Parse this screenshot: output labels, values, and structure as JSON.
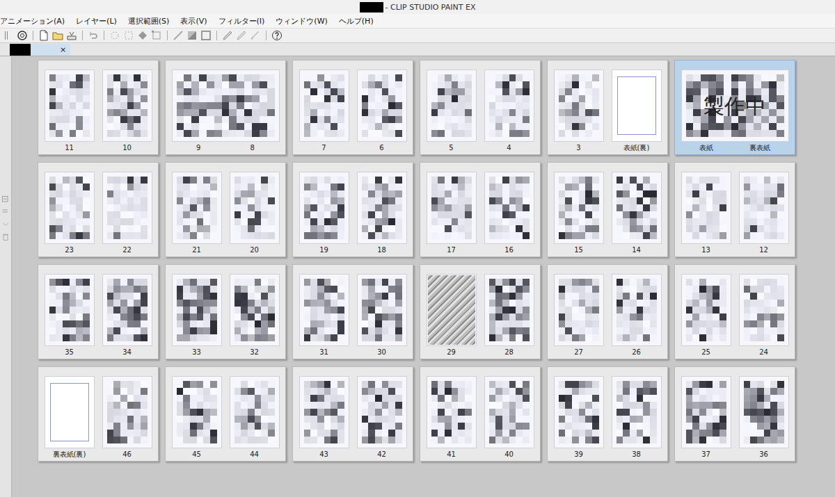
{
  "window": {
    "title": "- CLIP STUDIO PAINT EX"
  },
  "menu": [
    "アニメーション(A)",
    "レイヤー(L)",
    "選択範囲(S)",
    "表示(V)",
    "フィルター(I)",
    "ウィンドウ(W)",
    "ヘルプ(H)"
  ],
  "tabs": [
    {
      "close": "×",
      "selected": true
    }
  ],
  "spreads": [
    {
      "kind": "pair",
      "selected": false,
      "pages": [
        {
          "label": "11",
          "kind": "art"
        },
        {
          "label": "10",
          "kind": "art"
        }
      ]
    },
    {
      "kind": "wide",
      "selected": false,
      "pages": [
        {
          "label": "9",
          "kind": "art"
        },
        {
          "label": "8",
          "kind": "art"
        }
      ]
    },
    {
      "kind": "pair",
      "selected": false,
      "pages": [
        {
          "label": "7",
          "kind": "art"
        },
        {
          "label": "6",
          "kind": "art"
        }
      ]
    },
    {
      "kind": "pair",
      "selected": false,
      "pages": [
        {
          "label": "5",
          "kind": "art"
        },
        {
          "label": "4",
          "kind": "art"
        }
      ]
    },
    {
      "kind": "pair",
      "selected": false,
      "pages": [
        {
          "label": "3",
          "kind": "art"
        },
        {
          "label": "表紙(裏)",
          "kind": "blank"
        }
      ]
    },
    {
      "kind": "wide",
      "selected": true,
      "overlay": "製作中",
      "pages": [
        {
          "label": "表紙",
          "kind": "art"
        },
        {
          "label": "裏表紙",
          "kind": "art"
        }
      ]
    },
    {
      "kind": "pair",
      "selected": false,
      "pages": [
        {
          "label": "23",
          "kind": "art"
        },
        {
          "label": "22",
          "kind": "art"
        }
      ]
    },
    {
      "kind": "pair",
      "selected": false,
      "pages": [
        {
          "label": "21",
          "kind": "art"
        },
        {
          "label": "20",
          "kind": "art"
        }
      ]
    },
    {
      "kind": "pair",
      "selected": false,
      "pages": [
        {
          "label": "19",
          "kind": "art"
        },
        {
          "label": "18",
          "kind": "art"
        }
      ]
    },
    {
      "kind": "pair",
      "selected": false,
      "pages": [
        {
          "label": "17",
          "kind": "art"
        },
        {
          "label": "16",
          "kind": "art"
        }
      ]
    },
    {
      "kind": "pair",
      "selected": false,
      "pages": [
        {
          "label": "15",
          "kind": "art"
        },
        {
          "label": "14",
          "kind": "art"
        }
      ]
    },
    {
      "kind": "pair",
      "selected": false,
      "pages": [
        {
          "label": "13",
          "kind": "art"
        },
        {
          "label": "12",
          "kind": "art"
        }
      ]
    },
    {
      "kind": "pair",
      "selected": false,
      "pages": [
        {
          "label": "35",
          "kind": "art"
        },
        {
          "label": "34",
          "kind": "art"
        }
      ]
    },
    {
      "kind": "pair",
      "selected": false,
      "pages": [
        {
          "label": "33",
          "kind": "art"
        },
        {
          "label": "32",
          "kind": "art"
        }
      ]
    },
    {
      "kind": "pair",
      "selected": false,
      "pages": [
        {
          "label": "31",
          "kind": "art"
        },
        {
          "label": "30",
          "kind": "art"
        }
      ]
    },
    {
      "kind": "pair",
      "selected": false,
      "pages": [
        {
          "label": "29",
          "kind": "photo"
        },
        {
          "label": "28",
          "kind": "art"
        }
      ]
    },
    {
      "kind": "pair",
      "selected": false,
      "pages": [
        {
          "label": "27",
          "kind": "art"
        },
        {
          "label": "26",
          "kind": "art"
        }
      ]
    },
    {
      "kind": "pair",
      "selected": false,
      "pages": [
        {
          "label": "25",
          "kind": "art"
        },
        {
          "label": "24",
          "kind": "art"
        }
      ]
    },
    {
      "kind": "pair",
      "selected": false,
      "pages": [
        {
          "label": "裏表紙(裏)",
          "kind": "blank"
        },
        {
          "label": "46",
          "kind": "art"
        }
      ]
    },
    {
      "kind": "pair",
      "selected": false,
      "pages": [
        {
          "label": "45",
          "kind": "art"
        },
        {
          "label": "44",
          "kind": "art"
        }
      ]
    },
    {
      "kind": "pair",
      "selected": false,
      "pages": [
        {
          "label": "43",
          "kind": "art"
        },
        {
          "label": "42",
          "kind": "art"
        }
      ]
    },
    {
      "kind": "pair",
      "selected": false,
      "pages": [
        {
          "label": "41",
          "kind": "art"
        },
        {
          "label": "40",
          "kind": "art"
        }
      ]
    },
    {
      "kind": "pair",
      "selected": false,
      "pages": [
        {
          "label": "39",
          "kind": "art"
        },
        {
          "label": "38",
          "kind": "art"
        }
      ]
    },
    {
      "kind": "pair",
      "selected": false,
      "pages": [
        {
          "label": "37",
          "kind": "art"
        },
        {
          "label": "36",
          "kind": "art"
        }
      ]
    }
  ]
}
